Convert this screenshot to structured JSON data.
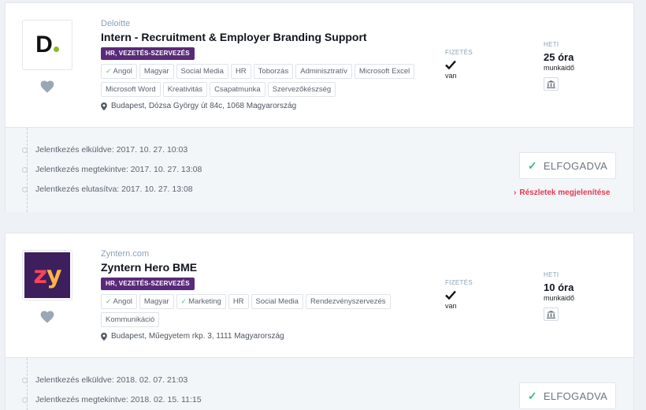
{
  "applications": [
    {
      "company": "Deloitte",
      "title": "Intern - Recruitment & Employer Branding Support",
      "category": "HR, VEZETÉS-SZERVEZÉS",
      "tags": [
        {
          "label": "Angol",
          "checked": true
        },
        {
          "label": "Magyar",
          "checked": false
        },
        {
          "label": "Social Media",
          "checked": false
        },
        {
          "label": "HR",
          "checked": false
        },
        {
          "label": "Toborzás",
          "checked": false
        },
        {
          "label": "Adminisztratív",
          "checked": false
        },
        {
          "label": "Microsoft Excel",
          "checked": false
        },
        {
          "label": "Microsoft Word",
          "checked": false
        },
        {
          "label": "Kreativitás",
          "checked": false
        },
        {
          "label": "Csapatmunka",
          "checked": false
        },
        {
          "label": "Szervezőkészség",
          "checked": false
        }
      ],
      "address": "Budapest, Dózsa György út 84c, 1068 Magyarország",
      "pay_label": "FIZETÉS",
      "pay_value": "van",
      "hours_label": "HETI",
      "hours_value": "25 óra",
      "hours_unit": "munkaidő",
      "timeline": [
        "Jelentkezés elküldve: 2017. 10. 27. 10:03",
        "Jelentkezés megtekintve: 2017. 10. 27. 13:08",
        "Jelentkezés elutasítva: 2017. 10. 27. 13:08"
      ],
      "status": "ELFOGADVA",
      "details_link": "Részletek megjelenítése"
    },
    {
      "company": "Zyntern.com",
      "title": "Zyntern Hero BME",
      "category": "HR, VEZETÉS-SZERVEZÉS",
      "tags": [
        {
          "label": "Angol",
          "checked": true
        },
        {
          "label": "Magyar",
          "checked": false
        },
        {
          "label": "Marketing",
          "checked": true
        },
        {
          "label": "HR",
          "checked": false
        },
        {
          "label": "Social Media",
          "checked": false
        },
        {
          "label": "Rendezvényszervezés",
          "checked": false
        },
        {
          "label": "Kommunikáció",
          "checked": false
        }
      ],
      "address": "Budapest, Műegyetem rkp. 3, 1111 Magyarország",
      "pay_label": "FIZETÉS",
      "pay_value": "van",
      "hours_label": "HETI",
      "hours_value": "10 óra",
      "hours_unit": "munkaidő",
      "timeline": [
        "Jelentkezés elküldve: 2018. 02. 07. 21:03",
        "Jelentkezés megtekintve: 2018. 02. 15. 11:15"
      ],
      "status": "ELFOGADVA"
    }
  ],
  "logos": {
    "deloitte_text": "D",
    "zyntern_z": "z",
    "zyntern_y": "y"
  },
  "colors": {
    "category_badge": "#5a2a78",
    "accept_check": "#3fb87f",
    "details_link": "#e8374f",
    "deloitte_dot": "#86bc25",
    "zyntern_bg": "#3c1f5c"
  }
}
